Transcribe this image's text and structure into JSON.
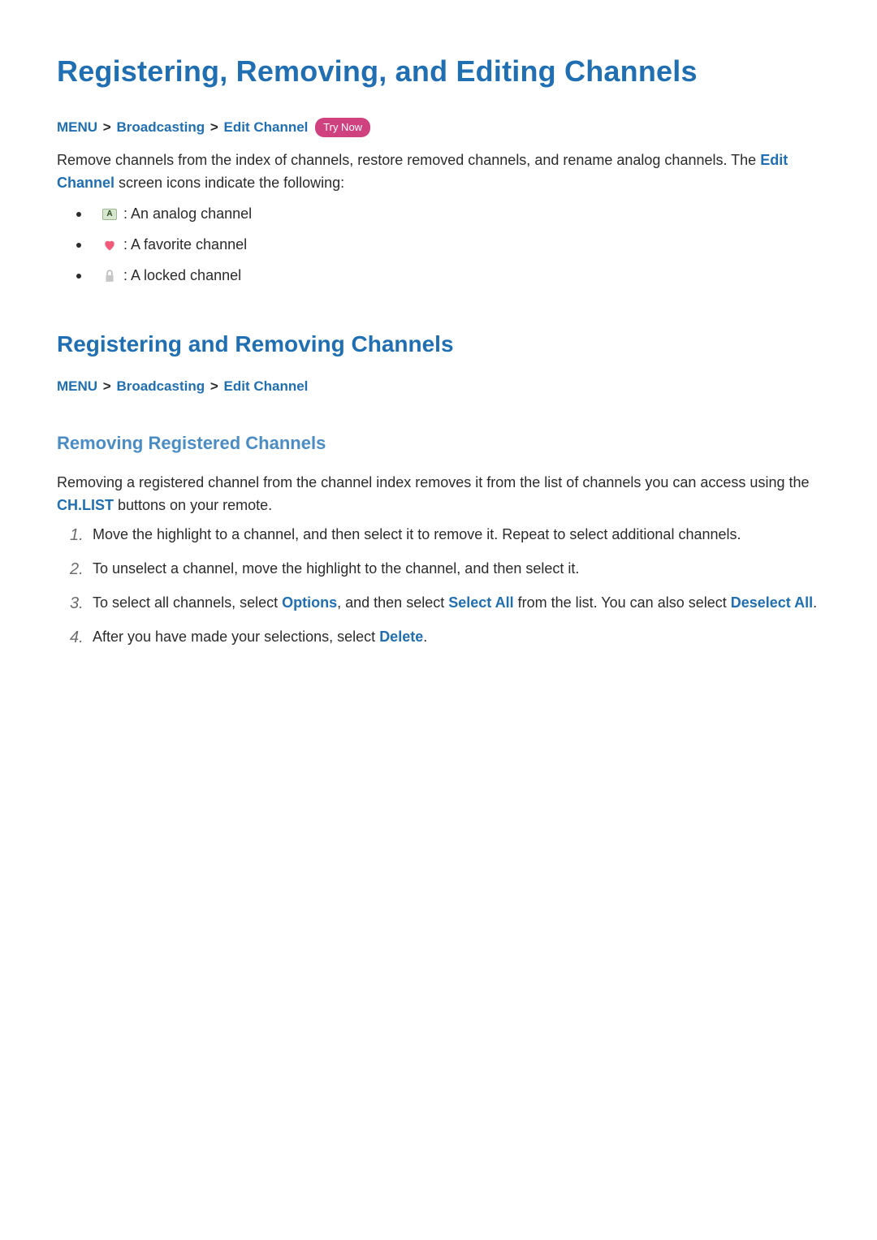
{
  "title_h1": "Registering, Removing, and Editing Channels",
  "breadcrumb1": {
    "items": [
      "MENU",
      "Broadcasting",
      "Edit Channel"
    ],
    "sep": ">",
    "tryNow": "Try Now"
  },
  "intro_part1": "Remove channels from the index of channels, restore removed channels, and rename analog channels. The ",
  "intro_strong": "Edit Channel",
  "intro_part2": " screen icons indicate the following:",
  "iconList": {
    "analog": {
      "glyph": "A",
      "text": " : An analog channel"
    },
    "favorite": {
      "text": " : A favorite channel"
    },
    "locked": {
      "text": " : A locked channel"
    }
  },
  "title_h2": "Registering and Removing Channels",
  "breadcrumb2": {
    "items": [
      "MENU",
      "Broadcasting",
      "Edit Channel"
    ],
    "sep": ">"
  },
  "title_h3": "Removing Registered Channels",
  "removing_p1a": "Removing a registered channel from the channel index removes it from the list of channels you can access using the ",
  "removing_p1_strong": "CH.LIST",
  "removing_p1b": " buttons on your remote.",
  "steps": {
    "s1": {
      "num": "1.",
      "text": "Move the highlight to a channel, and then select it to remove it. Repeat to select additional channels."
    },
    "s2": {
      "num": "2.",
      "text": "To unselect a channel, move the highlight to the channel, and then select it."
    },
    "s3": {
      "num": "3.",
      "pre": "To select all channels, select ",
      "kw_options": "Options",
      "mid1": ", and then select ",
      "kw_selectAll": "Select All",
      "mid2": " from the list. You can also select ",
      "kw_deselectAll": "Deselect All",
      "tail": "."
    },
    "s4": {
      "num": "4.",
      "pre": "After you have made your selections, select ",
      "kw_delete": "Delete",
      "tail": "."
    }
  }
}
